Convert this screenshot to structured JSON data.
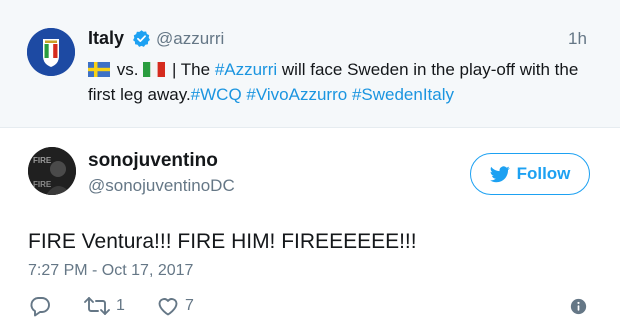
{
  "parent_tweet": {
    "name": "Italy",
    "handle": "@azzurri",
    "time": "1h",
    "text_before": "vs.",
    "text_sep": "| The",
    "hashtag_azzurri": "#Azzurri",
    "text_mid": "will face Sweden in the play-off with the first leg away.",
    "hashtags": [
      "#WCQ",
      "#VivoAzzurro",
      "#SwedenItaly"
    ],
    "flags": [
      "sweden-flag",
      "italy-flag"
    ]
  },
  "reply_tweet": {
    "name": "sonojuventino",
    "handle": "@sonojuventinoDC",
    "follow_label": "Follow",
    "text": "FIRE Ventura!!! FIRE HIM! FIREEEEEE!!!",
    "timestamp": "7:27 PM - Oct 17, 2017",
    "retweet_count": "1",
    "like_count": "7"
  },
  "colors": {
    "link": "#1b95e0",
    "follow_blue": "#1da1f2",
    "muted": "#657786",
    "parent_bg": "#f5f8fa"
  }
}
